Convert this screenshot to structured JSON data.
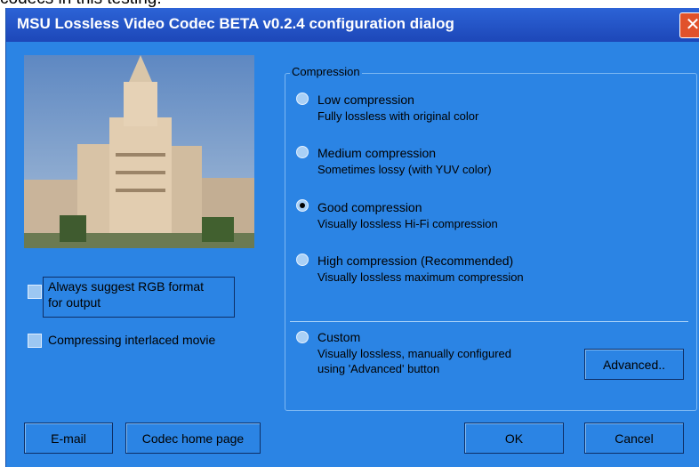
{
  "cut_text": "codecs in this testing:",
  "window": {
    "title": "MSU Lossless Video Codec BETA v0.2.4 configuration dialog",
    "close_glyph": "✕"
  },
  "options": {
    "always_rgb_line1": "Always suggest RGB format",
    "always_rgb_line2": "for output",
    "interlaced": "Compressing interlaced movie"
  },
  "compression": {
    "group_title": "Compression",
    "selected": "good",
    "items": [
      {
        "id": "low",
        "title": "Low compression",
        "desc": "Fully lossless with original color"
      },
      {
        "id": "medium",
        "title": "Medium compression",
        "desc": "Sometimes lossy (with YUV color)"
      },
      {
        "id": "good",
        "title": "Good compression",
        "desc": "Visually lossless Hi-Fi compression"
      },
      {
        "id": "high",
        "title": "High compression   (Recommended)",
        "desc": "Visually lossless maximum compression"
      },
      {
        "id": "custom",
        "title": "Custom",
        "desc": "Visually lossless, manually configured",
        "desc2": "using 'Advanced' button"
      }
    ]
  },
  "buttons": {
    "advanced": "Advanced..",
    "email": "E-mail",
    "home": "Codec home page",
    "ok": "OK",
    "cancel": "Cancel"
  },
  "colors": {
    "dialog_bg": "#2b84e4",
    "titlebar": "#1d47b8",
    "close": "#e1522b"
  },
  "icons": {
    "close": "close-icon",
    "preview": "building-photo"
  }
}
